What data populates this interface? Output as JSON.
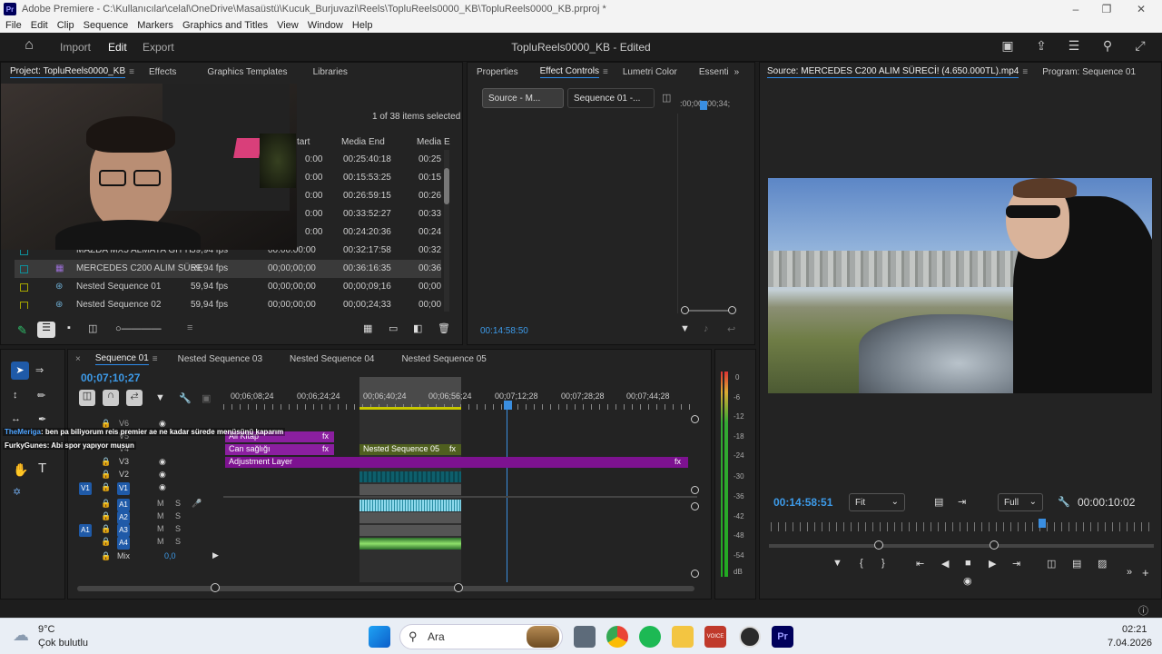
{
  "window": {
    "title": "Adobe Premiere - C:\\Kullanıcılar\\celal\\OneDrive\\Masaüstü\\Kucuk_Burjuvazi\\Reels\\TopluReels0000_KB\\TopluReels0000_KB.prproj *",
    "app_icon": "Pr"
  },
  "menu": [
    "File",
    "Edit",
    "Clip",
    "Sequence",
    "Markers",
    "Graphics and Titles",
    "View",
    "Window",
    "Help"
  ],
  "header": {
    "tabs": [
      "Import",
      "Edit",
      "Export"
    ],
    "active_tab": "Edit",
    "document": "TopluReels0000_KB - Edited"
  },
  "project_panel": {
    "tabs": [
      "Project: TopluReels0000_KB",
      "Effects",
      "Graphics Templates",
      "Libraries"
    ],
    "selection_status": "1 of 38 items selected",
    "columns": [
      "tart",
      "Media End",
      "Media E"
    ],
    "rows": [
      {
        "name": "",
        "fps": "",
        "start": "0:00",
        "end": "00:25:40:18",
        "end2": "00:25"
      },
      {
        "name": "",
        "fps": "",
        "start": "0:00",
        "end": "00:15:53:25",
        "end2": "00:15"
      },
      {
        "name": "",
        "fps": "",
        "start": "0:00",
        "end": "00:26:59:15",
        "end2": "00:26"
      },
      {
        "name": "",
        "fps": "",
        "start": "0:00",
        "end": "00:33:52:27",
        "end2": "00:33"
      },
      {
        "name": "",
        "fps": "",
        "start": "0:00",
        "end": "00:24:20:36",
        "end2": "00:24"
      },
      {
        "name": "MAZDA MX5 ALMAYA GITTI",
        "fps": "59,94 fps",
        "start": "00:00:00:00",
        "end": "00:32:17:58",
        "end2": "00:32"
      },
      {
        "name": "MERCEDES C200 ALIM SÜRE",
        "fps": "59,94 fps",
        "start": "00;00;00;00",
        "end": "00:36:16:35",
        "end2": "00:36"
      },
      {
        "name": "Nested Sequence 01",
        "fps": "59,94 fps",
        "start": "00;00;00;00",
        "end": "00;00;09;16",
        "end2": "00;00"
      },
      {
        "name": "Nested Sequence 02",
        "fps": "59,94 fps",
        "start": "00;00;00;00",
        "end": "00;00;24;33",
        "end2": "00;00"
      }
    ]
  },
  "effect_controls": {
    "tabs": [
      "Properties",
      "Effect Controls",
      "Lumetri Color",
      "Essenti"
    ],
    "source_dropdown": "Source - M...",
    "sequence_dropdown": "Sequence 01 -...",
    "ruler": [
      ":00;00",
      "00;34;"
    ],
    "timecode": "00:14:58:50"
  },
  "source_monitor": {
    "tabs": [
      "Source: MERCEDES C200 ALIM SÜRECİ! (4.650.000TL).mp4",
      "Program: Sequence 01"
    ],
    "timecode": "00:14:58:51",
    "fit": "Fit",
    "quality": "Full",
    "duration": "00:00:10:02"
  },
  "timeline": {
    "tabs": [
      "Sequence 01",
      "Nested Sequence 03",
      "Nested Sequence 04",
      "Nested Sequence 05"
    ],
    "timecode": "00;07;10;27",
    "ruler": [
      "00;06;08;24",
      "00;06;24;24",
      "00;06;40;24",
      "00;06;56;24",
      "00;07;12;28",
      "00;07;28;28",
      "00;07;44;28"
    ],
    "video_tracks": [
      "V6",
      "V5",
      "V4",
      "V3",
      "V2",
      "V1"
    ],
    "audio_tracks": [
      "A1",
      "A2",
      "A3",
      "A4"
    ],
    "mix_label": "Mix",
    "mix_value": "0,0",
    "source_v": "V1",
    "source_a": "A1",
    "clips": {
      "all_kitap": "All Kitap",
      "can_sagligi": "Can sağlığı",
      "nested05": "Nested Sequence 05",
      "adjustment": "Adjustment Layer",
      "fx": "fx"
    }
  },
  "meter_scale": [
    "0",
    "-6",
    "-12",
    "-18",
    "-24",
    "-30",
    "-36",
    "-42",
    "-48",
    "-54",
    "dB"
  ],
  "chat": [
    {
      "user": "TheMeriga",
      "text": ": ben pa biliyorum reis premier ae ne kadar sürede menüsünü kaparım"
    },
    {
      "user": "FurkyGunes",
      "text": ": Abi spor yapıyor musun"
    }
  ],
  "taskbar": {
    "weather_temp": "9°C",
    "weather_desc": "Çok bulutlu",
    "search": "Ara",
    "time": "02:21",
    "date": "7.04.2026"
  }
}
